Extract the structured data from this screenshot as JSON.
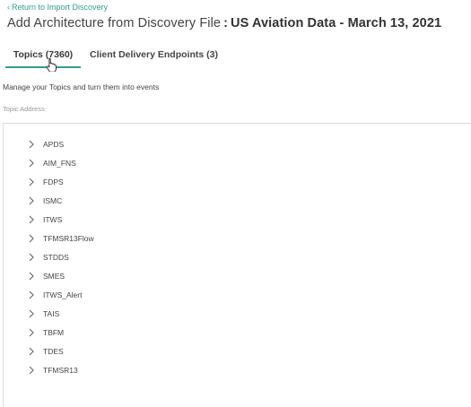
{
  "header": {
    "back_link": "Return to Import Discovery",
    "title_prefix": "Add Architecture from Discovery File",
    "title_separator": ":",
    "title_dataset": "US Aviation Data - March 13, 2021"
  },
  "tabs": [
    {
      "label": "Topics (7360)",
      "active": true
    },
    {
      "label": "Client Delivery Endpoints (3)",
      "active": false
    }
  ],
  "main": {
    "description": "Manage your Topics and turn them into events",
    "topic_address_label": "Topic Address:"
  },
  "topics": [
    {
      "label": "APDS"
    },
    {
      "label": "AIM_FNS"
    },
    {
      "label": "FDPS"
    },
    {
      "label": "ISMC"
    },
    {
      "label": "ITWS"
    },
    {
      "label": "TFMSR13Flow"
    },
    {
      "label": "STDDS"
    },
    {
      "label": "SMES"
    },
    {
      "label": "ITWS_Alert"
    },
    {
      "label": "TAIS"
    },
    {
      "label": "TBFM"
    },
    {
      "label": "TDES"
    },
    {
      "label": "TFMSR13"
    }
  ],
  "colors": {
    "accent": "#2f9e8f",
    "text": "#444444",
    "muted": "#999999",
    "border": "#dcdcdc"
  },
  "icons": {
    "back": "chevron-left-icon",
    "expander": "chevron-right-icon",
    "cursor": "hand-pointer-icon"
  }
}
